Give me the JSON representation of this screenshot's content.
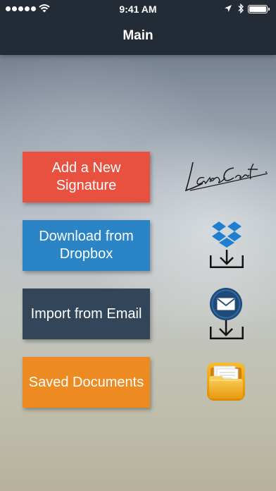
{
  "status_bar": {
    "time": "9:41 AM",
    "icons": [
      "signal-dots-icon",
      "wifi-icon",
      "location-arrow-icon",
      "bluetooth-icon",
      "battery-icon"
    ]
  },
  "nav": {
    "title": "Main"
  },
  "menu": {
    "add_signature": "Add a New\nSignature",
    "download_dropbox": "Download from\nDropbox",
    "import_email": "Import from Email",
    "saved_documents": "Saved Documents"
  },
  "icons": {
    "signature": "signature-image-icon",
    "dropbox": "dropbox-download-icon",
    "email": "email-download-icon",
    "folder": "saved-folder-icon"
  },
  "colors": {
    "top_bar": "#232c36",
    "add_signature": "#e8513f",
    "download_dropbox": "#2a84c6",
    "import_email": "#334559",
    "saved_documents": "#ee8a22"
  }
}
